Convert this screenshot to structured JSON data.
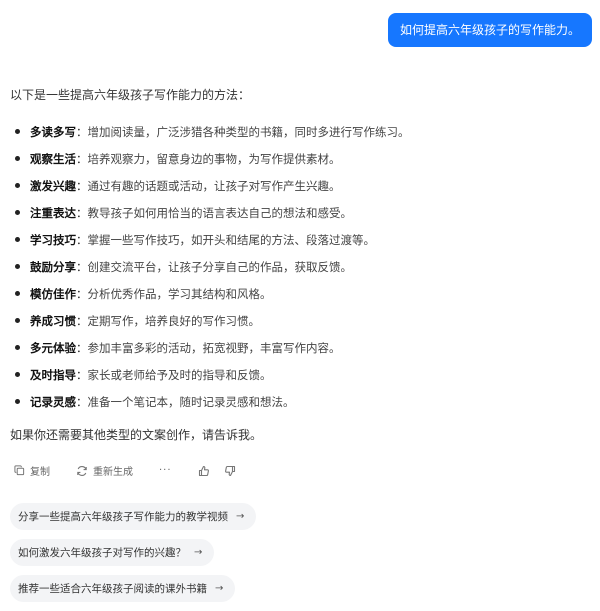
{
  "user_message": "如何提高六年级孩子的写作能力。",
  "reply": {
    "intro": "以下是一些提高六年级孩子写作能力的方法：",
    "tips": [
      {
        "title": "多读多写",
        "desc": "增加阅读量，广泛涉猎各种类型的书籍，同时多进行写作练习。"
      },
      {
        "title": "观察生活",
        "desc": "培养观察力，留意身边的事物，为写作提供素材。"
      },
      {
        "title": "激发兴趣",
        "desc": "通过有趣的话题或活动，让孩子对写作产生兴趣。"
      },
      {
        "title": "注重表达",
        "desc": "教导孩子如何用恰当的语言表达自己的想法和感受。"
      },
      {
        "title": "学习技巧",
        "desc": "掌握一些写作技巧，如开头和结尾的方法、段落过渡等。"
      },
      {
        "title": "鼓励分享",
        "desc": "创建交流平台，让孩子分享自己的作品，获取反馈。"
      },
      {
        "title": "模仿佳作",
        "desc": "分析优秀作品，学习其结构和风格。"
      },
      {
        "title": "养成习惯",
        "desc": "定期写作，培养良好的写作习惯。"
      },
      {
        "title": "多元体验",
        "desc": "参加丰富多彩的活动，拓宽视野，丰富写作内容。"
      },
      {
        "title": "及时指导",
        "desc": "家长或老师给予及时的指导和反馈。"
      },
      {
        "title": "记录灵感",
        "desc": "准备一个笔记本，随时记录灵感和想法。"
      }
    ],
    "separator": "：",
    "outro": "如果你还需要其他类型的文案创作，请告诉我。"
  },
  "actions": {
    "copy_label": "复制",
    "regenerate_label": "重新生成",
    "more_label": "···"
  },
  "suggestions": [
    "分享一些提高六年级孩子写作能力的教学视频",
    "如何激发六年级孩子对写作的兴趣？",
    "推荐一些适合六年级孩子阅读的课外书籍"
  ],
  "colors": {
    "accent": "#1677ff",
    "suggestion_bg": "#f3f4f6"
  },
  "icons": [
    "copy-icon",
    "regenerate-icon",
    "thumbs-up-icon",
    "thumbs-down-icon",
    "arrow-right-icon"
  ]
}
